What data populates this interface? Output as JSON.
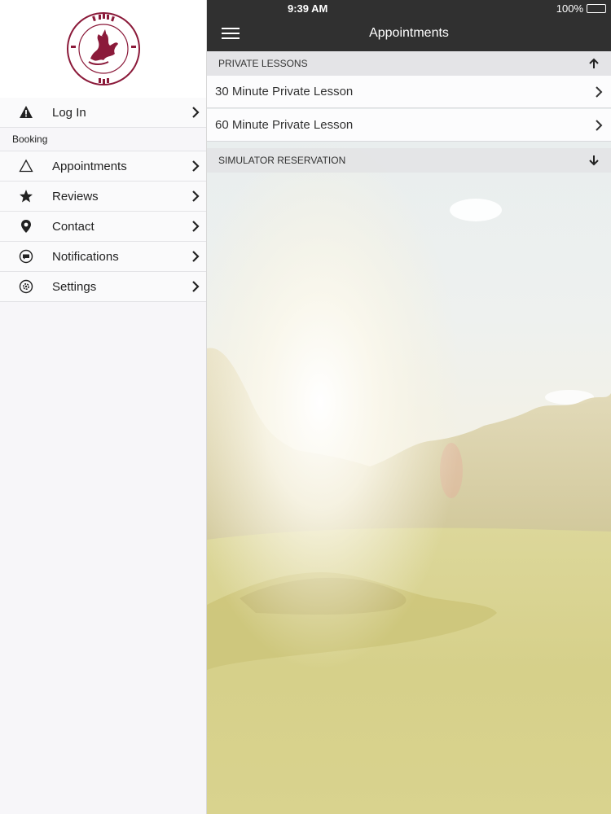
{
  "status": {
    "time": "9:39 AM",
    "battery": "100%"
  },
  "navbar": {
    "title": "Appointments"
  },
  "sidebar": {
    "items_top": [
      {
        "label": "Log In",
        "icon": "warning-icon"
      }
    ],
    "section_label": "Booking",
    "items": [
      {
        "label": "Appointments",
        "icon": "triangle-outline-icon"
      },
      {
        "label": "Reviews",
        "icon": "star-icon"
      },
      {
        "label": "Contact",
        "icon": "map-pin-icon"
      },
      {
        "label": "Notifications",
        "icon": "chat-bubble-icon"
      },
      {
        "label": "Settings",
        "icon": "gear-icon"
      }
    ]
  },
  "main": {
    "private_lessons": {
      "header": "PRIVATE LESSONS",
      "expanded": true,
      "items": [
        {
          "label": "30 Minute Private Lesson"
        },
        {
          "label": "60 Minute Private Lesson"
        }
      ]
    },
    "simulator": {
      "header": "SIMULATOR RESERVATION",
      "expanded": false
    }
  },
  "colors": {
    "brand": "#8b1a3a",
    "navbar": "#303030",
    "sidebar_bg": "#f7f6f9"
  }
}
